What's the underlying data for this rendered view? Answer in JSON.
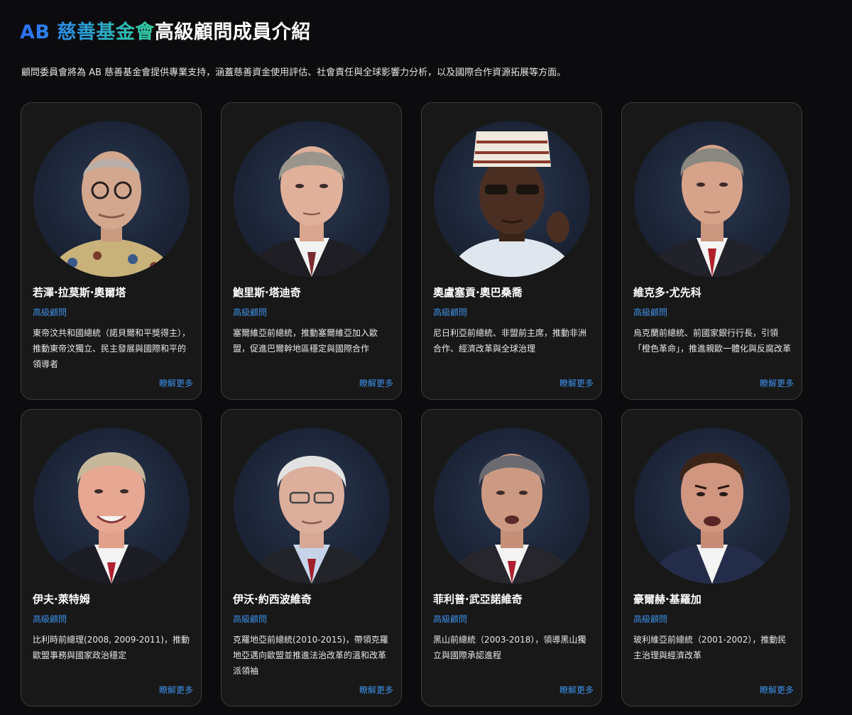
{
  "header": {
    "brand": "AB 慈善基金會",
    "title_rest": "高級顧問成員介紹",
    "intro": "顧問委員會將為 AB 慈善基金會提供專業支持，涵蓋慈善資金使用評估、社會責任與全球影響力分析，以及國際合作資源拓展等方面。"
  },
  "advisors": [
    {
      "name": "若澤·拉莫斯·奧爾塔",
      "role": "高級顧問",
      "desc": "東帝汶共和國總統（諾貝爾和平獎得主），推動東帝汶獨立、民主發展與國際和平的領導者",
      "more": "瞭解更多"
    },
    {
      "name": "鮑里斯·塔迪奇",
      "role": "高級顧問",
      "desc": "塞爾維亞前總統，推動塞爾維亞加入歐盟，促進巴爾幹地區穩定與國際合作",
      "more": "瞭解更多"
    },
    {
      "name": "奧盧塞貢·奧巴桑喬",
      "role": "高級顧問",
      "desc": "尼日利亞前總統、非盟前主席，推動非洲合作、經濟改革與全球治理",
      "more": "瞭解更多"
    },
    {
      "name": "維克多·尤先科",
      "role": "高級顧問",
      "desc": "烏克蘭前總統、前國家銀行行長，引領「橙色革命」，推進親歐一體化與反腐改革",
      "more": "瞭解更多"
    },
    {
      "name": "伊夫·萊特姆",
      "role": "高級顧問",
      "desc": "比利時前總理(2008, 2009-2011)，推動歐盟事務與國家政治穩定",
      "more": "瞭解更多"
    },
    {
      "name": "伊沃·約西波維奇",
      "role": "高級顧問",
      "desc": "克羅地亞前總統(2010-2015)，帶領克羅地亞邁向歐盟並推進法治改革的溫和改革派領袖",
      "more": "瞭解更多"
    },
    {
      "name": "菲利普·武亞諾維奇",
      "role": "高級顧問",
      "desc": "黑山前總統（2003-2018），領導黑山獨立與國際承認進程",
      "more": "瞭解更多"
    },
    {
      "name": "豪爾赫·基羅加",
      "role": "高級顧問",
      "desc": "玻利維亞前總統（2001-2002），推動民主治理與經濟改革",
      "more": "瞭解更多"
    }
  ],
  "colors": {
    "background": "#0c0c0e",
    "card": "#181818",
    "accent": "#3d8fe8",
    "gradient_start": "#2b6ef7",
    "gradient_end": "#32d0a0"
  }
}
